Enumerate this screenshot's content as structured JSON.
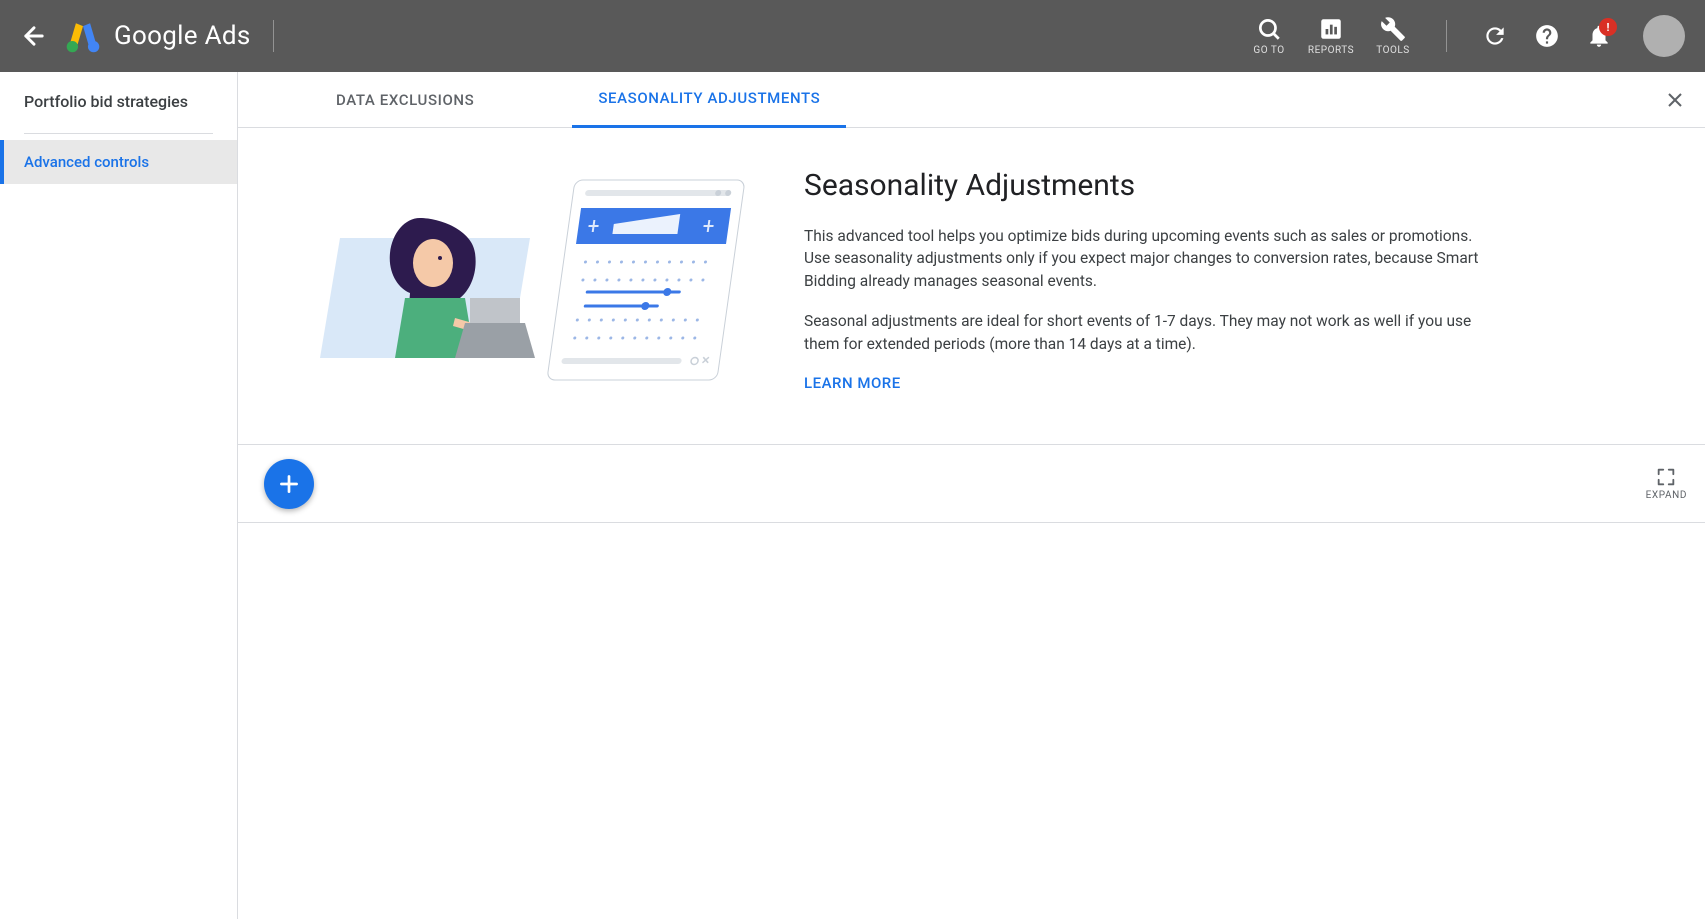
{
  "header": {
    "product_name": "Google Ads",
    "tools": {
      "goto": "GO TO",
      "reports": "REPORTS",
      "tools": "TOOLS"
    },
    "notification_badge": "!"
  },
  "sidebar": {
    "title": "Portfolio bid strategies",
    "items": [
      {
        "label": "Advanced controls",
        "active": true
      }
    ]
  },
  "tabs": [
    {
      "label": "DATA EXCLUSIONS",
      "active": false
    },
    {
      "label": "SEASONALITY ADJUSTMENTS",
      "active": true
    }
  ],
  "hero": {
    "title": "Seasonality Adjustments",
    "p1": "This advanced tool helps you optimize bids during upcoming events such as sales or promotions. Use seasonality adjustments only if you expect major changes to conversion rates, because Smart Bidding already manages seasonal events.",
    "p2": "Seasonal adjustments are ideal for short events of 1-7 days. They may not work as well if you use them for extended periods (more than 14 days at a time).",
    "learn_more": "LEARN MORE"
  },
  "toolbar": {
    "expand": "EXPAND"
  }
}
